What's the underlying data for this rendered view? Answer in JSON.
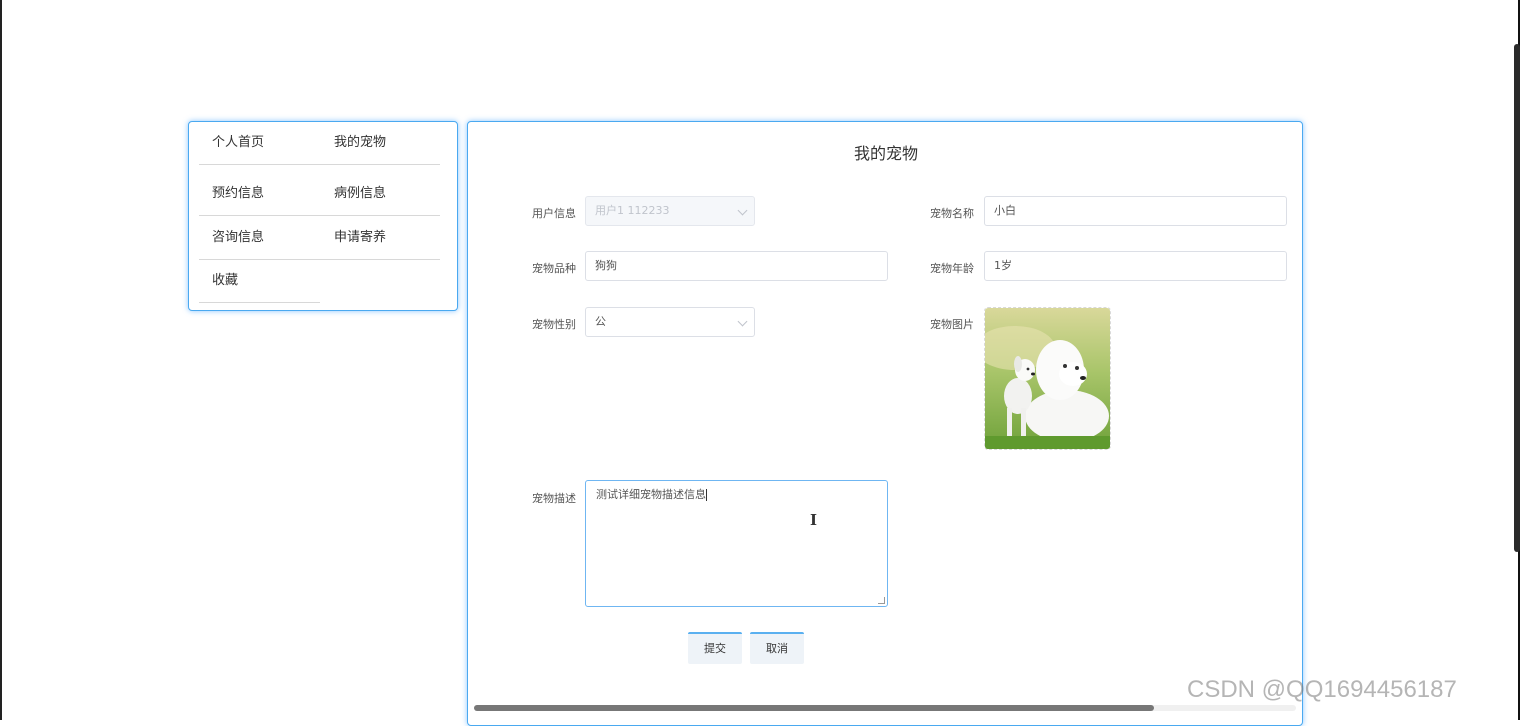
{
  "sidebar": {
    "items": [
      {
        "label": "个人首页"
      },
      {
        "label": "我的宠物"
      },
      {
        "label": "预约信息"
      },
      {
        "label": "病例信息"
      },
      {
        "label": "咨询信息"
      },
      {
        "label": "申请寄养"
      },
      {
        "label": "收藏"
      }
    ]
  },
  "form": {
    "title": "我的宠物",
    "user_info": {
      "label": "用户信息",
      "value": "用户1 112233"
    },
    "pet_name": {
      "label": "宠物名称",
      "value": "小白"
    },
    "pet_breed": {
      "label": "宠物品种",
      "value": "狗狗"
    },
    "pet_age": {
      "label": "宠物年龄",
      "value": "1岁"
    },
    "pet_gender": {
      "label": "宠物性别",
      "value": "公"
    },
    "pet_image": {
      "label": "宠物图片"
    },
    "pet_description": {
      "label": "宠物描述",
      "value": "测试详细宠物描述信息"
    },
    "submit_label": "提交",
    "cancel_label": "取消"
  },
  "watermark": "CSDN @QQ1694456187",
  "colors": {
    "accent": "#4aa9f0",
    "border": "#dcdfe6",
    "disabled_bg": "#f5f7fa"
  }
}
